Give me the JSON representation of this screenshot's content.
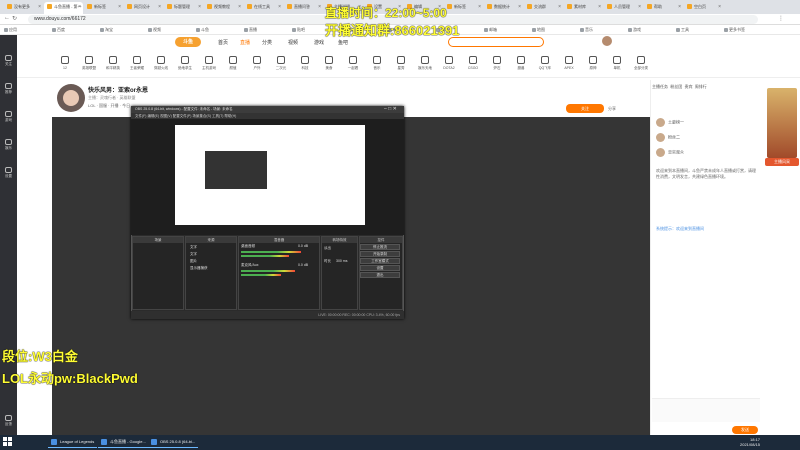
{
  "browser": {
    "tabs": [
      {
        "label": "没有更多"
      },
      {
        "label": "斗鱼直播 - 第一"
      },
      {
        "label": "新标签"
      },
      {
        "label": "网页设计"
      },
      {
        "label": "标题管理"
      },
      {
        "label": "视频教程"
      },
      {
        "label": "在线工具"
      },
      {
        "label": "直播问答"
      },
      {
        "label": "主播说明"
      },
      {
        "label": "设置"
      },
      {
        "label": "编辑"
      },
      {
        "label": "新标签"
      },
      {
        "label": "数据统计"
      },
      {
        "label": "交流群"
      },
      {
        "label": "素材库"
      },
      {
        "label": "人员管理"
      },
      {
        "label": "帮助"
      },
      {
        "label": "空白页"
      }
    ],
    "url": "www.douyu.com/66172",
    "bookmarks": [
      "应用",
      "百度",
      "淘宝",
      "视频",
      "斗鱼",
      "直播",
      "贴吧",
      "网盘",
      "新闻",
      "翻译",
      "邮箱",
      "地图",
      "音乐",
      "游戏",
      "工具",
      "更多书签"
    ]
  },
  "sidebar": {
    "items": [
      {
        "label": "关注"
      },
      {
        "label": "推荐"
      },
      {
        "label": "游戏"
      },
      {
        "label": "娱乐"
      },
      {
        "label": "设置"
      }
    ],
    "bottom_label": "反馈"
  },
  "site": {
    "logo": "斗鱼",
    "nav": [
      "首页",
      "直播",
      "分类",
      "视频",
      "游戏",
      "鱼吧"
    ],
    "nav_active": 1,
    "categories": [
      "12",
      "英雄联盟",
      "和平精英",
      "王者荣耀",
      "穿越火线",
      "绝地求生",
      "主机游戏",
      "颜值",
      "户外",
      "二次元",
      "科技",
      "美食",
      "一起看",
      "音乐",
      "星秀",
      "娱乐天地",
      "DOTA2",
      "CSGO",
      "炉石",
      "魔兽",
      "QQ飞车",
      "APEX",
      "原神",
      "单机",
      "全部分类"
    ]
  },
  "overlay": {
    "schedule_line": "直播时间：22:00~5:00",
    "group_line": "开播通知群:866021391",
    "rank_line": "段位:W3白金",
    "password_line": "LOL永动pw:BlackPwd"
  },
  "stream": {
    "title": "快乐风男：亚索or永恩",
    "meta": "主播：灵魂行者 · 英雄联盟",
    "tags": "LOL · 国服 · 开播 · 今日",
    "follow": "关注",
    "share": "分享"
  },
  "obs": {
    "title": "OBS 25.0.8 (64-bit, windows) - 配置文件: 未命名 - 场景: 未命名",
    "menu": "文件(F)  编辑(E)  视图(V)  配置文件(P)  场景集合(S)  工具(T)  帮助(H)",
    "panels": {
      "scenes": "场景",
      "sources": "来源",
      "mixer": "混音器",
      "transitions": "转场特效",
      "controls": "控件"
    },
    "sources": [
      "文字",
      "文字",
      "图片",
      "显示器捕获"
    ],
    "mixer_tracks": [
      "桌面音频",
      "麦克风/Aux"
    ],
    "mixer_db": [
      "0.0 dB",
      "0.0 dB"
    ],
    "transition": "淡出",
    "duration_label": "时长",
    "duration": "300 ms",
    "buttons": [
      "停止推流",
      "开始录制",
      "工作室模式",
      "设置",
      "退出"
    ],
    "status": "LIVE: 00:00:00   REC: 00:00:00   CPU: 3.4%, 60.00 fps"
  },
  "right_panel": {
    "tabs": [
      "主播任务",
      "粉丝团",
      "贵宾",
      "周排行"
    ],
    "ranks": [
      {
        "name": "土豪榜一"
      },
      {
        "name": "粉丝二"
      },
      {
        "name": "忠实观众"
      }
    ],
    "chat": "欢迎来到本直播间，斗鱼严禁未成年人直播或打赏，请理性消费，文明发言，共建绿色直播环境。",
    "system_msg": "系统提示：欢迎来到直播间",
    "send": "发送"
  },
  "taskbar": {
    "items": [
      "League of Legends",
      "斗鱼直播 - Google...",
      "OBS 25.0.8 (64-bi..."
    ],
    "time": "18:17",
    "date": "2021/08/15"
  },
  "ads": {
    "banner": "主播风采"
  }
}
